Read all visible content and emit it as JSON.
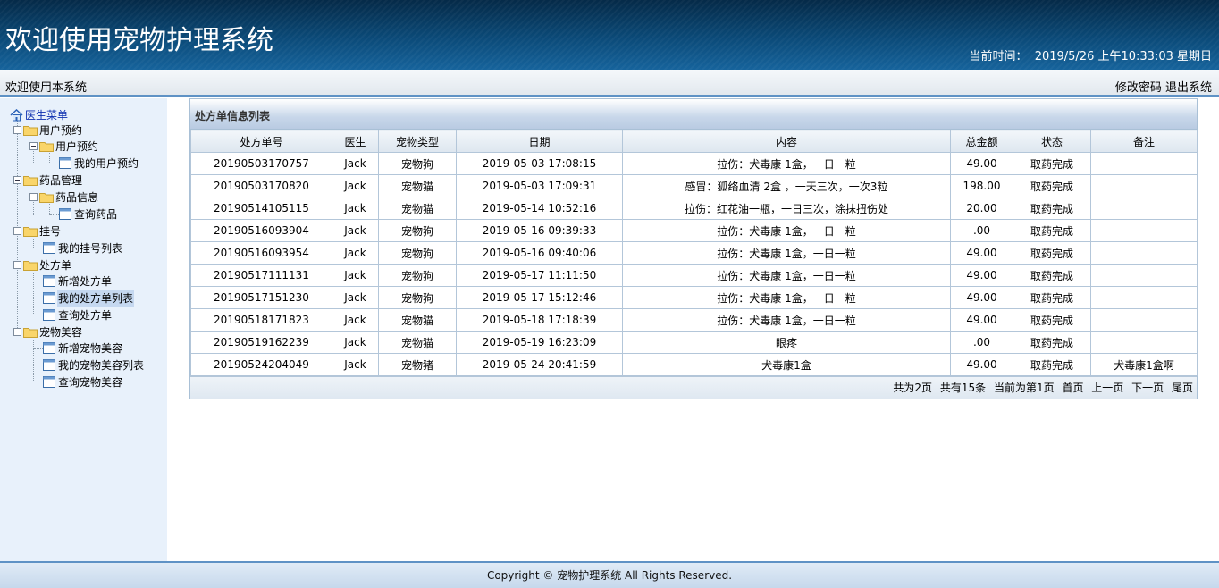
{
  "header": {
    "title": "欢迎使用宠物护理系统",
    "time_label": "当前时间：",
    "time_value": "2019/5/26 上午10:33:03 星期日"
  },
  "subbar": {
    "welcome": "欢迎使用本系统",
    "change_password": "修改密码",
    "logout": "退出系统"
  },
  "menu": {
    "root": "医生菜单",
    "items": [
      "用户预约",
      "用户预约",
      "我的用户预约",
      "药品管理",
      "药品信息",
      "查询药品",
      "挂号",
      "我的挂号列表",
      "处方单",
      "新增处方单",
      "我的处方单列表",
      "查询处方单",
      "宠物美容",
      "新增宠物美容",
      "我的宠物美容列表",
      "查询宠物美容"
    ]
  },
  "panel": {
    "title": "处方单信息列表",
    "columns": [
      "处方单号",
      "医生",
      "宠物类型",
      "日期",
      "内容",
      "总金额",
      "状态",
      "备注"
    ],
    "rows": [
      [
        "20190503170757",
        "Jack",
        "宠物狗",
        "2019-05-03 17:08:15",
        "拉伤：犬毒康 1盒，一日一粒",
        "49.00",
        "取药完成",
        ""
      ],
      [
        "20190503170820",
        "Jack",
        "宠物猫",
        "2019-05-03 17:09:31",
        "感冒：狐络血清 2盒 ，一天三次，一次3粒",
        "198.00",
        "取药完成",
        ""
      ],
      [
        "20190514105115",
        "Jack",
        "宠物猫",
        "2019-05-14 10:52:16",
        "拉伤：红花油一瓶，一日三次，涂抹扭伤处",
        "20.00",
        "取药完成",
        ""
      ],
      [
        "20190516093904",
        "Jack",
        "宠物狗",
        "2019-05-16 09:39:33",
        "拉伤：犬毒康 1盒，一日一粒",
        ".00",
        "取药完成",
        ""
      ],
      [
        "20190516093954",
        "Jack",
        "宠物狗",
        "2019-05-16 09:40:06",
        "拉伤：犬毒康 1盒，一日一粒",
        "49.00",
        "取药完成",
        ""
      ],
      [
        "20190517111131",
        "Jack",
        "宠物狗",
        "2019-05-17 11:11:50",
        "拉伤：犬毒康 1盒，一日一粒",
        "49.00",
        "取药完成",
        ""
      ],
      [
        "20190517151230",
        "Jack",
        "宠物狗",
        "2019-05-17 15:12:46",
        "拉伤：犬毒康 1盒，一日一粒",
        "49.00",
        "取药完成",
        ""
      ],
      [
        "20190518171823",
        "Jack",
        "宠物猫",
        "2019-05-18 17:18:39",
        "拉伤：犬毒康 1盒，一日一粒",
        "49.00",
        "取药完成",
        ""
      ],
      [
        "20190519162239",
        "Jack",
        "宠物猫",
        "2019-05-19 16:23:09",
        "眼疼",
        ".00",
        "取药完成",
        ""
      ],
      [
        "20190524204049",
        "Jack",
        "宠物猪",
        "2019-05-24 20:41:59",
        "犬毒康1盒",
        "49.00",
        "取药完成",
        "犬毒康1盒啊"
      ]
    ],
    "pager": {
      "total_pages": "共为2页",
      "total_items": "共有15条",
      "current": "当前为第1页",
      "first": "首页",
      "prev": "上一页",
      "next": "下一页",
      "last": "尾页"
    }
  },
  "footer": {
    "copyright": "Copyright © 宠物护理系统 All Rights Reserved."
  },
  "colors": {
    "header_dark": "#052a48",
    "header_light": "#16639b",
    "accent_border": "#5f92c5",
    "sidebar_bg": "#e8f1fb",
    "menu_root": "#0c2fb0"
  }
}
